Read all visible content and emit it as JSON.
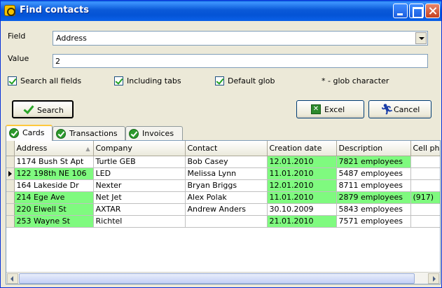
{
  "window": {
    "title": "Find contacts"
  },
  "form": {
    "field_label": "Field",
    "field_value": "Address",
    "value_label": "Value",
    "value_text": "2",
    "checkboxes": [
      {
        "label": "Search all fields",
        "checked": true
      },
      {
        "label": "Including tabs",
        "checked": true
      },
      {
        "label": "Default glob",
        "checked": true
      }
    ],
    "glob_hint": "* - glob character"
  },
  "buttons": {
    "search": "Search",
    "excel": "Excel",
    "cancel": "Cancel"
  },
  "tabs": [
    {
      "label": "Cards",
      "active": true
    },
    {
      "label": "Transactions",
      "active": false
    },
    {
      "label": "Invoices",
      "active": false
    }
  ],
  "grid": {
    "columns": [
      "Address",
      "Company",
      "Contact",
      "Creation date",
      "Description",
      "Cell ph"
    ],
    "rows": [
      {
        "cells": [
          "1174 Bush St Apt",
          "Turtle GEB",
          "Bob Casey",
          "12.01.2010",
          "7821 employees",
          ""
        ],
        "current": false
      },
      {
        "cells": [
          "122 198th NE 106",
          "LED",
          "Melissa Lynn",
          "11.01.2010",
          "5487 employees",
          ""
        ],
        "current": true
      },
      {
        "cells": [
          "164 Lakeside Dr",
          "Nexter",
          "Bryan Briggs",
          "12.01.2010",
          "8711 employees",
          ""
        ],
        "current": false
      },
      {
        "cells": [
          "214 Ege Ave",
          "Net Jet",
          "Alex Polak",
          "11.01.2010",
          "2879 employees",
          "(917)"
        ],
        "current": false
      },
      {
        "cells": [
          "220 Elwell St",
          "AXTAR",
          "Andrew Anders",
          "30.10.2009",
          "5843 employees",
          ""
        ],
        "current": false
      },
      {
        "cells": [
          "253 Wayne St",
          "Richtel",
          "",
          "21.01.2010",
          "7571 employees",
          ""
        ],
        "current": false
      }
    ]
  },
  "colors": {
    "highlight": "#7ffa7f",
    "titlebar": "#0453d6"
  }
}
